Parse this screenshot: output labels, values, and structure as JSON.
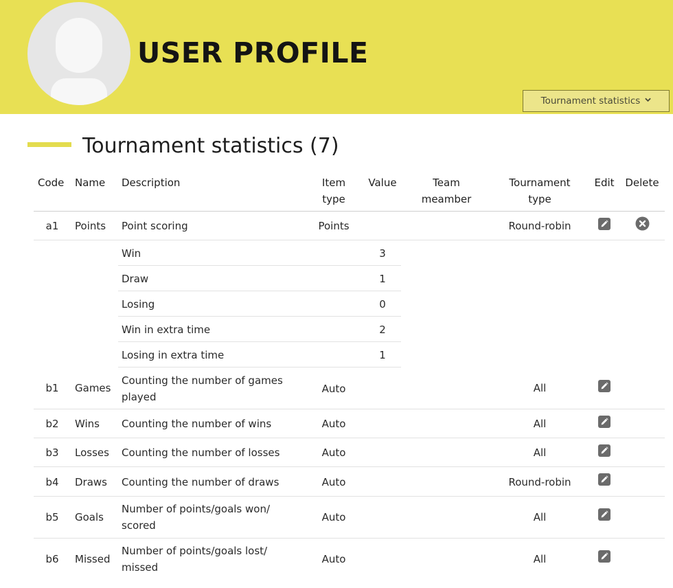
{
  "header": {
    "title": "USER PROFILE",
    "dropdown_label": "Tournament statistics"
  },
  "section": {
    "title": "Tournament statistics (7)"
  },
  "columns": {
    "code": "Code",
    "name": "Name",
    "description": "Description",
    "item_type_1": "Item",
    "item_type_2": "type",
    "value": "Value",
    "team_1": "Team",
    "team_2": "meamber",
    "tournament_1": "Tournament",
    "tournament_2": "type",
    "edit": "Edit",
    "delete": "Delete"
  },
  "rows": [
    {
      "code": "a1",
      "name": "Points",
      "desc_1": "Point scoring",
      "desc_2": "",
      "item_type": "Points",
      "tournament": "Round-robin"
    },
    {
      "code": "b1",
      "name": "Games",
      "desc_1": "Counting the number of games",
      "desc_2": "played",
      "item_type": "Auto",
      "tournament": "All"
    },
    {
      "code": "b2",
      "name": "Wins",
      "desc_1": "Counting the number of wins",
      "desc_2": "",
      "item_type": "Auto",
      "tournament": "All"
    },
    {
      "code": "b3",
      "name": "Losses",
      "desc_1": "Counting the number of losses",
      "desc_2": "",
      "item_type": "Auto",
      "tournament": "All"
    },
    {
      "code": "b4",
      "name": "Draws",
      "desc_1": "Counting the number of draws",
      "desc_2": "",
      "item_type": "Auto",
      "tournament": "Round-robin"
    },
    {
      "code": "b5",
      "name": "Goals",
      "desc_1": "Number of points/goals won/",
      "desc_2": "scored",
      "item_type": "Auto",
      "tournament": "All"
    },
    {
      "code": "b6",
      "name": "Missed",
      "desc_1": "Number of points/goals lost/",
      "desc_2": "missed",
      "item_type": "Auto",
      "tournament": "All"
    }
  ],
  "sub_rows": [
    {
      "label": "Win",
      "value": "3"
    },
    {
      "label": "Draw",
      "value": "1"
    },
    {
      "label": "Losing",
      "value": "0"
    },
    {
      "label": "Win in extra time",
      "value": "2"
    },
    {
      "label": "Losing in extra time",
      "value": "1"
    }
  ],
  "icons": {
    "edit": "pencil-icon",
    "delete": "close-circle-icon",
    "chevron": "chevron-down-icon",
    "avatar": "user-avatar-icon"
  },
  "colors": {
    "header_bg": "#e8e054",
    "accent_bar": "#e3dc4e",
    "dropdown_bg": "#ece58a",
    "icon": "#6b6b6b"
  }
}
